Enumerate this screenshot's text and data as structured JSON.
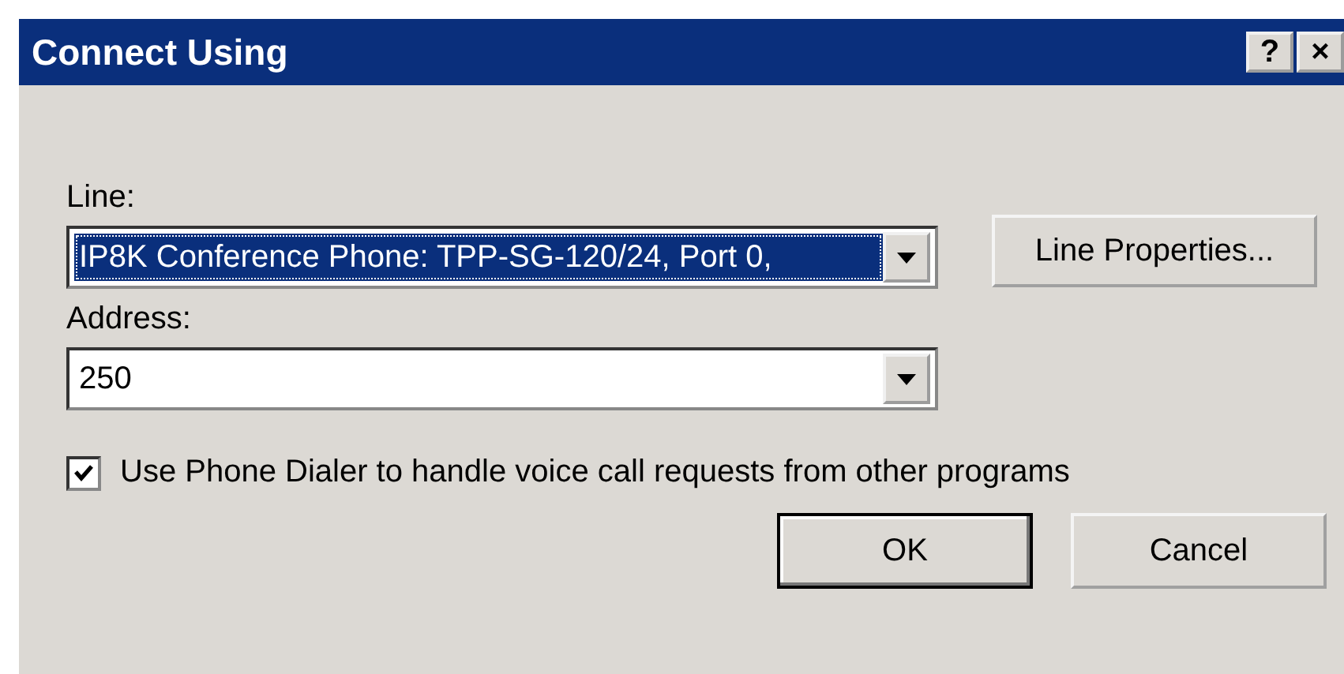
{
  "window": {
    "title": "Connect Using",
    "buttons": [
      "?",
      "×"
    ]
  },
  "line": {
    "label": "Line:",
    "value": "IP8K Conference Phone: TPP-SG-120/24, Port 0,",
    "focused": true
  },
  "line_properties_button": "Line Properties...",
  "address": {
    "label": "Address:",
    "value": "250"
  },
  "phone_dialer_option": {
    "label": "Use Phone Dialer to handle voice call requests from other programs",
    "checked": true
  },
  "buttons": [
    {
      "label": "OK",
      "default": true
    },
    {
      "label": "Cancel",
      "default": false
    }
  ]
}
